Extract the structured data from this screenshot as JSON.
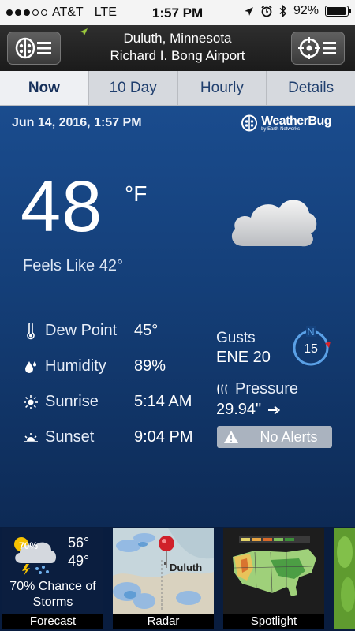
{
  "status_bar": {
    "carrier": "AT&T",
    "network": "LTE",
    "time": "1:57 PM",
    "battery": "92%",
    "battery_level": 0.92
  },
  "header": {
    "city": "Duluth, Minnesota",
    "station": "Richard I. Bong Airport"
  },
  "tabs": [
    {
      "label": "Now",
      "active": true
    },
    {
      "label": "10 Day",
      "active": false
    },
    {
      "label": "Hourly",
      "active": false
    },
    {
      "label": "Details",
      "active": false
    }
  ],
  "current": {
    "date": "Jun 14, 2016, 1:57 PM",
    "brand": "WeatherBug",
    "brand_sub": "by Earth Networks",
    "temperature": "48",
    "unit": "°F",
    "feels_like": "Feels Like 42°"
  },
  "details": [
    {
      "icon": "thermometer-icon",
      "label": "Dew Point",
      "value": "45°"
    },
    {
      "icon": "humidity-icon",
      "label": "Humidity",
      "value": "89%"
    },
    {
      "icon": "sunrise-icon",
      "label": "Sunrise",
      "value": "5:14 AM"
    },
    {
      "icon": "sunset-icon",
      "label": "Sunset",
      "value": "9:04 PM"
    }
  ],
  "wind": {
    "gusts_label": "Gusts",
    "direction_speed": "ENE 20",
    "compass_north": "N",
    "compass_speed": "15"
  },
  "pressure": {
    "label": "Pressure",
    "value": "29.94\""
  },
  "alerts": {
    "label": "No Alerts"
  },
  "cards": {
    "forecast": {
      "caption": "Forecast",
      "high": "56°",
      "low": "49°",
      "precip_badge": "70%",
      "description": "70% Chance of Storms"
    },
    "radar": {
      "caption": "Radar",
      "city": "Duluth"
    },
    "spotlight": {
      "caption": "Spotlight"
    }
  },
  "colors": {
    "accent_blue": "#1a4c8e",
    "compass_ring": "#5aa0e6",
    "compass_marker": "#d8232a"
  }
}
